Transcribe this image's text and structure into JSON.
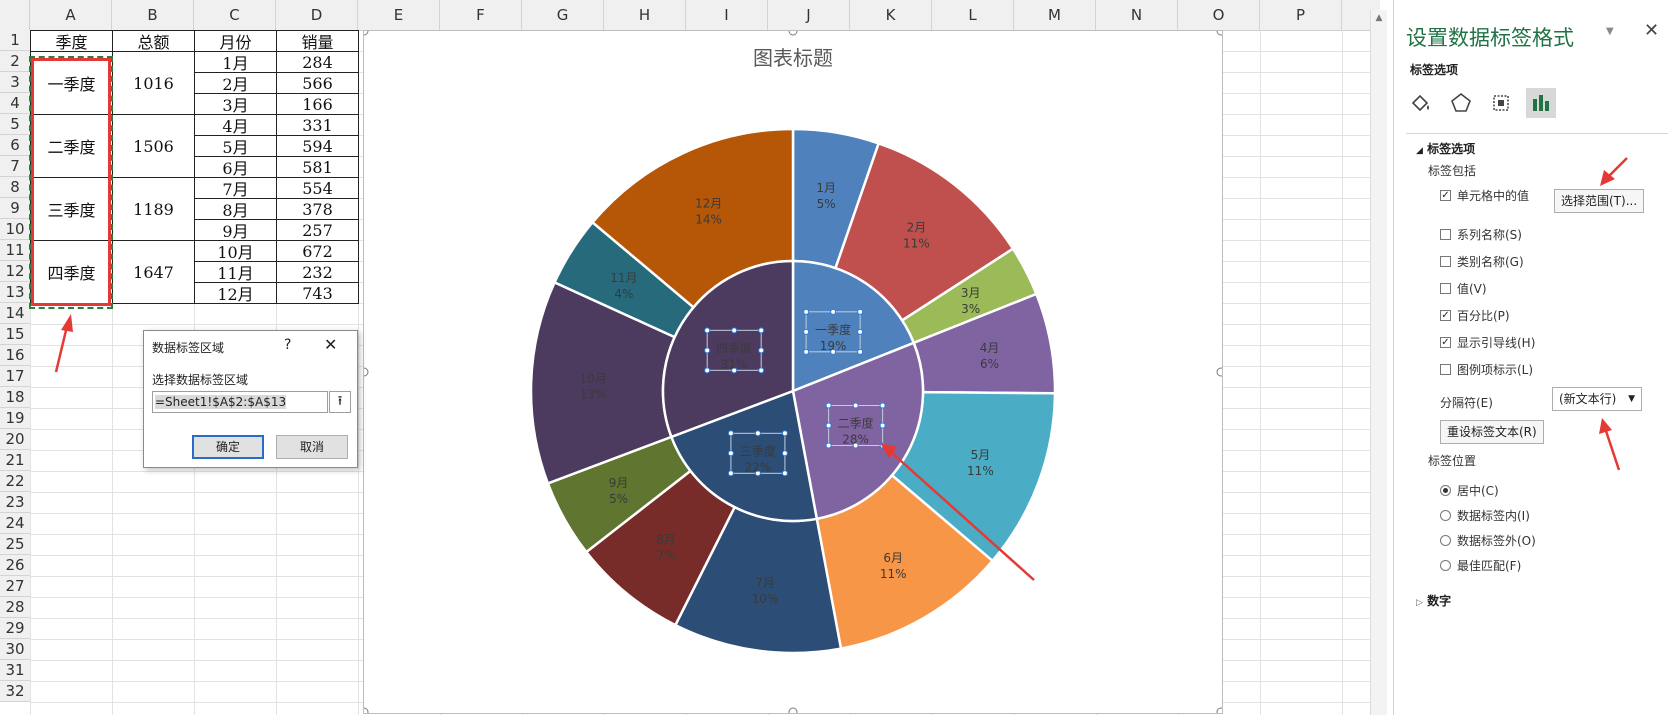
{
  "spreadsheet": {
    "columns": [
      "A",
      "B",
      "C",
      "D",
      "E",
      "F",
      "G",
      "H",
      "I",
      "J",
      "K",
      "L",
      "M",
      "N",
      "O",
      "P"
    ],
    "rows": [
      "1",
      "2",
      "3",
      "4",
      "5",
      "6",
      "7",
      "8",
      "9",
      "10",
      "11",
      "12",
      "13",
      "14",
      "15",
      "16",
      "17",
      "18",
      "19",
      "20",
      "21",
      "22",
      "23",
      "24",
      "25",
      "26",
      "27",
      "28",
      "29",
      "30",
      "31",
      "32"
    ],
    "headers": [
      "季度",
      "总额",
      "月份",
      "销量"
    ],
    "quarters": [
      {
        "name": "一季度",
        "total": "1016"
      },
      {
        "name": "二季度",
        "total": "1506"
      },
      {
        "name": "三季度",
        "total": "1189"
      },
      {
        "name": "四季度",
        "total": "1647"
      }
    ],
    "months": [
      {
        "m": "1月",
        "v": "284"
      },
      {
        "m": "2月",
        "v": "566"
      },
      {
        "m": "3月",
        "v": "166"
      },
      {
        "m": "4月",
        "v": "331"
      },
      {
        "m": "5月",
        "v": "594"
      },
      {
        "m": "6月",
        "v": "581"
      },
      {
        "m": "7月",
        "v": "554"
      },
      {
        "m": "8月",
        "v": "378"
      },
      {
        "m": "9月",
        "v": "257"
      },
      {
        "m": "10月",
        "v": "672"
      },
      {
        "m": "11月",
        "v": "232"
      },
      {
        "m": "12月",
        "v": "743"
      }
    ]
  },
  "chart_data": {
    "type": "pie",
    "title": "图表标题",
    "inner": {
      "categories": [
        "一季度",
        "二季度",
        "三季度",
        "四季度"
      ],
      "values": [
        1016,
        1506,
        1189,
        1647
      ],
      "percent_labels": [
        "19%",
        "28%",
        "22%",
        "31%"
      ],
      "colors": [
        "#4f81bd",
        "#8064a2",
        "#2c4d75",
        "#4c3b5f"
      ]
    },
    "outer": {
      "categories": [
        "1月",
        "2月",
        "3月",
        "4月",
        "5月",
        "6月",
        "7月",
        "8月",
        "9月",
        "10月",
        "11月",
        "12月"
      ],
      "values": [
        284,
        566,
        166,
        331,
        594,
        581,
        554,
        378,
        257,
        672,
        232,
        743
      ],
      "percent_labels": [
        "5%",
        "11%",
        "3%",
        "6%",
        "11%",
        "11%",
        "10%",
        "7%",
        "5%",
        "13%",
        "4%",
        "14%"
      ],
      "colors": [
        "#4f81bd",
        "#c0504d",
        "#9bbb59",
        "#8064a2",
        "#4bacc6",
        "#f79646",
        "#2c4d75",
        "#772c2a",
        "#5f7530",
        "#4c3b5f",
        "#276a7c",
        "#b65708"
      ]
    }
  },
  "dialog": {
    "title": "数据标签区域",
    "help": "?",
    "close": "✕",
    "label": "选择数据标签区域",
    "range": "=Sheet1!$A$2:$A$13",
    "ok": "确定",
    "cancel": "取消"
  },
  "panel": {
    "title": "设置数据标签格式",
    "tab_name": "标签选项",
    "section_label_options": "标签选项",
    "label_contains": "标签包括",
    "checkboxes": [
      {
        "label": "单元格中的值",
        "checked": true
      },
      {
        "label": "系列名称(S)",
        "checked": false
      },
      {
        "label": "类别名称(G)",
        "checked": false
      },
      {
        "label": "值(V)",
        "checked": false
      },
      {
        "label": "百分比(P)",
        "checked": true
      },
      {
        "label": "显示引导线(H)",
        "checked": true
      },
      {
        "label": "图例项标示(L)",
        "checked": false
      }
    ],
    "select_range_button": "选择范围(T)...",
    "separator_label": "分隔符(E)",
    "separator_value": "(新文本行)",
    "reset_button": "重设标签文本(R)",
    "position_label": "标签位置",
    "positions": [
      {
        "label": "居中(C)",
        "selected": true
      },
      {
        "label": "数据标签内(I)",
        "selected": false
      },
      {
        "label": "数据标签外(O)",
        "selected": false
      },
      {
        "label": "最佳匹配(F)",
        "selected": false
      }
    ],
    "number_section": "数字"
  },
  "annotation_color": "#e53935"
}
